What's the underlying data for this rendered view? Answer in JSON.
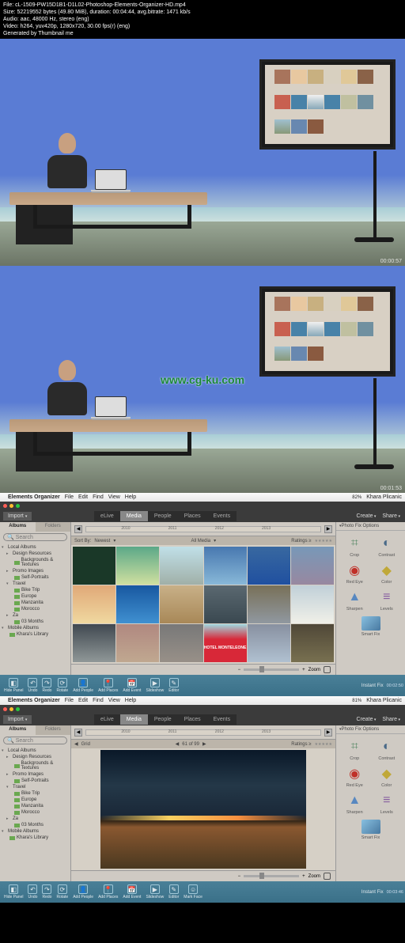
{
  "meta": {
    "file": "File: cL-1509-PW15D1B1-D1L02-Photoshop-Elements-Organizer-HD.mp4",
    "size": "Size: 52219552 bytes (49.80 MiB), duration: 00:04:44, avg.bitrate: 1471 kb/s",
    "audio": "Audio: aac, 48000 Hz, stereo (eng)",
    "video": "Video: h264, yuv420p, 1280x720, 30.00 fps(r) (eng)",
    "gen": "Generated by Thumbnail me"
  },
  "video": {
    "watermark": "www.cg-ku.com",
    "tc1": "00:00:57",
    "tc2": "00:01:53"
  },
  "mac_menu": {
    "apple": "",
    "app": "Elements Organizer",
    "items": [
      "File",
      "Edit",
      "Find",
      "View",
      "Help"
    ],
    "wifi": "",
    "battery_pct": "82%",
    "user": "Khara Plicanic"
  },
  "mac_menu2_battery": "81%",
  "topnav": {
    "import": "Import",
    "tabs": [
      "eLive",
      "Media",
      "People",
      "Places",
      "Events"
    ],
    "create": "Create",
    "share": "Share"
  },
  "lefttabs": {
    "albums": "Albums",
    "folders": "Folders"
  },
  "tree": {
    "local": "Local Albums",
    "design": "Design Resources",
    "backgrounds": "Backgrounds & Textures",
    "promo": "Promo Images",
    "selfp": "Self-Portraits",
    "travel": "Travel",
    "biketrip": "Bike Trip",
    "europe": "Europe",
    "manzanita": "Manzanita",
    "morocco": "Morocco",
    "za": "Za",
    "months": "03 Months",
    "mobile": "Mobile Albums",
    "library": "Khara's Library"
  },
  "timeline": {
    "years": [
      "2010",
      "2011",
      "2012",
      "2013"
    ]
  },
  "filter": {
    "sortby": "Sort By:",
    "newest": "Newest",
    "allmedia": "All Media",
    "grid": "Grid",
    "count": "61 of 99",
    "ratings": "Ratings ≥"
  },
  "hotel": "HOTEL MONTELEONE",
  "zoom": "Zoom",
  "fix": {
    "hdr": "Photo Fix Options",
    "crop": "Crop",
    "contrast": "Contrast",
    "redeye": "Red Eye",
    "color": "Color",
    "sharpen": "Sharpen",
    "levels": "Levels",
    "smart": "Smart Fix"
  },
  "bottom": {
    "hide": "Hide Panel",
    "undo": "Undo",
    "redo": "Redo",
    "rotate": "Rotate",
    "addpeople": "Add People",
    "addplaces": "Add Places",
    "addevent": "Add Event",
    "slideshow": "Slideshow",
    "editor": "Editor",
    "markface": "Mark Face",
    "instant": "Instant Fix",
    "tc3": "00:02:50",
    "tc4": "00:03:46"
  },
  "search_placeholder": "Search"
}
